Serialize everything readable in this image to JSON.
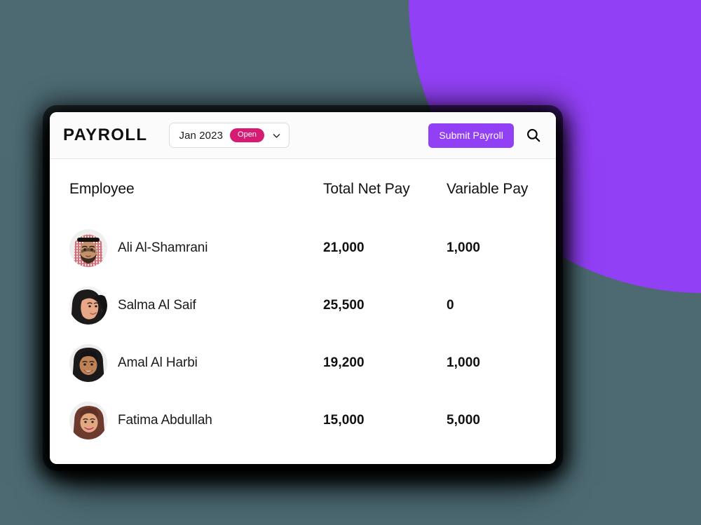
{
  "background": {
    "page_color": "#4d6a73",
    "accent_shape_color": "#9240f5"
  },
  "card": {
    "header": {
      "brand_title": "PAYROLL",
      "period_selector": {
        "period_label": "Jan 2023",
        "status_badge": "Open",
        "status_badge_color": "#d81b72",
        "chevron_icon": "chevron-down-icon"
      },
      "submit_button_label": "Submit Payroll",
      "submit_button_color": "#9240f5",
      "search_icon": "search-icon"
    },
    "table": {
      "columns": [
        "Employee",
        "Total Net Pay",
        "Variable Pay"
      ],
      "rows": [
        {
          "name": "Ali Al-Shamrani",
          "total_net_pay": "21,000",
          "variable_pay": "1,000",
          "avatar": "avatar-male-keffiyeh"
        },
        {
          "name": "Salma Al Saif",
          "total_net_pay": "25,500",
          "variable_pay": "0",
          "avatar": "avatar-female-black-hijab-side"
        },
        {
          "name": "Amal Al Harbi",
          "total_net_pay": "19,200",
          "variable_pay": "1,000",
          "avatar": "avatar-female-black-hijab-smiling"
        },
        {
          "name": "Fatima Abdullah",
          "total_net_pay": "15,000",
          "variable_pay": "5,000",
          "avatar": "avatar-female-brown-hijab"
        }
      ]
    }
  }
}
